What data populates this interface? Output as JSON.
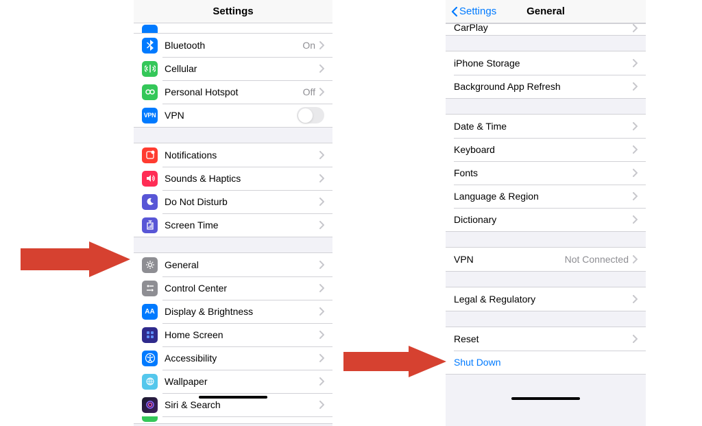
{
  "left": {
    "title": "Settings",
    "groups": [
      {
        "rows": [
          {
            "icon": "bluetooth",
            "label": "Bluetooth",
            "detail": "On",
            "chevron": true
          },
          {
            "icon": "cellular",
            "label": "Cellular",
            "chevron": true
          },
          {
            "icon": "hotspot",
            "label": "Personal Hotspot",
            "detail": "Off",
            "chevron": true
          },
          {
            "icon": "vpn",
            "label": "VPN",
            "toggle": false
          }
        ]
      },
      {
        "rows": [
          {
            "icon": "notifications",
            "label": "Notifications",
            "chevron": true
          },
          {
            "icon": "sounds",
            "label": "Sounds & Haptics",
            "chevron": true
          },
          {
            "icon": "dnd",
            "label": "Do Not Disturb",
            "chevron": true
          },
          {
            "icon": "screentime",
            "label": "Screen Time",
            "chevron": true
          }
        ]
      },
      {
        "rows": [
          {
            "icon": "general",
            "label": "General",
            "chevron": true
          },
          {
            "icon": "control",
            "label": "Control Center",
            "chevron": true
          },
          {
            "icon": "display",
            "label": "Display & Brightness",
            "chevron": true
          },
          {
            "icon": "home",
            "label": "Home Screen",
            "chevron": true
          },
          {
            "icon": "access",
            "label": "Accessibility",
            "chevron": true
          },
          {
            "icon": "wallpaper",
            "label": "Wallpaper",
            "chevron": true
          },
          {
            "icon": "siri",
            "label": "Siri & Search",
            "chevron": true
          }
        ]
      }
    ]
  },
  "right": {
    "back": "Settings",
    "title": "General",
    "groups": [
      {
        "rows": [
          {
            "label": "CarPlay",
            "chevron": true,
            "partialTop": true
          }
        ]
      },
      {
        "rows": [
          {
            "label": "iPhone Storage",
            "chevron": true
          },
          {
            "label": "Background App Refresh",
            "chevron": true
          }
        ]
      },
      {
        "rows": [
          {
            "label": "Date & Time",
            "chevron": true
          },
          {
            "label": "Keyboard",
            "chevron": true
          },
          {
            "label": "Fonts",
            "chevron": true
          },
          {
            "label": "Language & Region",
            "chevron": true
          },
          {
            "label": "Dictionary",
            "chevron": true
          }
        ]
      },
      {
        "rows": [
          {
            "label": "VPN",
            "detail": "Not Connected",
            "chevron": true
          }
        ]
      },
      {
        "rows": [
          {
            "label": "Legal & Regulatory",
            "chevron": true
          }
        ]
      },
      {
        "rows": [
          {
            "label": "Reset",
            "chevron": true
          },
          {
            "label": "Shut Down",
            "blue": true
          }
        ]
      }
    ]
  }
}
